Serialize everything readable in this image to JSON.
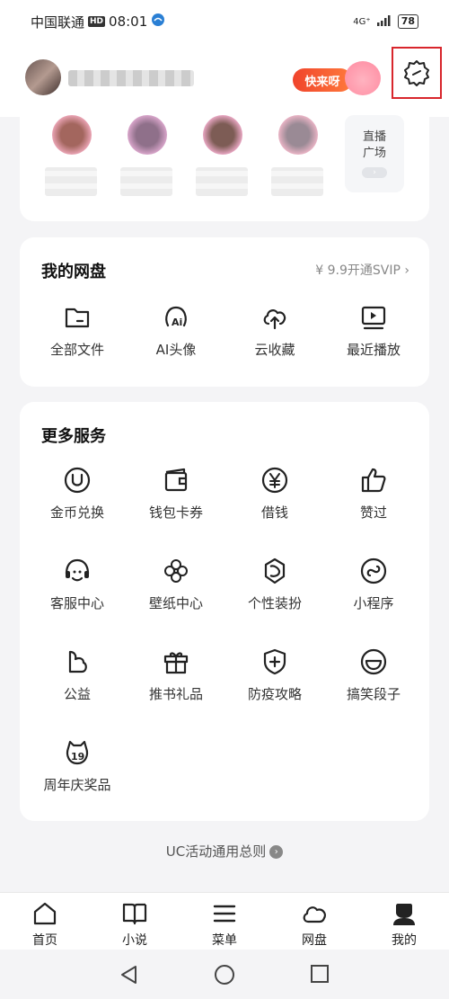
{
  "status_bar": {
    "carrier": "中国联通",
    "hd": "HD",
    "time": "08:01",
    "network": "4G⁺",
    "battery": "78"
  },
  "header": {
    "promo_label": "快来呀"
  },
  "live": {
    "plaza_line1": "直播",
    "plaza_line2": "广场",
    "plaza_arrow": "›"
  },
  "netdisk": {
    "title": "我的网盘",
    "vip_link": "¥ 9.9开通SVIP ›",
    "items": [
      {
        "label": "全部文件",
        "icon": "folder-icon"
      },
      {
        "label": "AI头像",
        "icon": "ai-avatar-icon"
      },
      {
        "label": "云收藏",
        "icon": "cloud-upload-icon"
      },
      {
        "label": "最近播放",
        "icon": "play-screen-icon"
      }
    ]
  },
  "services": {
    "title": "更多服务",
    "items": [
      {
        "label": "金币兑换",
        "icon": "coin-icon"
      },
      {
        "label": "钱包卡券",
        "icon": "wallet-icon"
      },
      {
        "label": "借钱",
        "icon": "yen-icon"
      },
      {
        "label": "赞过",
        "icon": "thumbs-up-icon"
      },
      {
        "label": "客服中心",
        "icon": "headset-icon"
      },
      {
        "label": "壁纸中心",
        "icon": "wallpaper-icon"
      },
      {
        "label": "个性装扮",
        "icon": "theme-icon"
      },
      {
        "label": "小程序",
        "icon": "mini-program-icon"
      },
      {
        "label": "公益",
        "icon": "charity-icon"
      },
      {
        "label": "推书礼品",
        "icon": "gift-icon"
      },
      {
        "label": "防疫攻略",
        "icon": "shield-plus-icon"
      },
      {
        "label": "搞笑段子",
        "icon": "smile-icon"
      },
      {
        "label": "周年庆奖品",
        "icon": "anniversary-icon"
      }
    ]
  },
  "footer": {
    "rules_link": "UC活动通用总则",
    "rules_arrow": "›"
  },
  "tabs": [
    {
      "label": "首页",
      "icon": "home-icon"
    },
    {
      "label": "小说",
      "icon": "book-icon"
    },
    {
      "label": "菜单",
      "icon": "menu-icon"
    },
    {
      "label": "网盘",
      "icon": "cloud-icon"
    },
    {
      "label": "我的",
      "icon": "user-icon"
    }
  ],
  "colors": {
    "accent_red": "#d8262c",
    "promo_orange": "#f0442c"
  }
}
